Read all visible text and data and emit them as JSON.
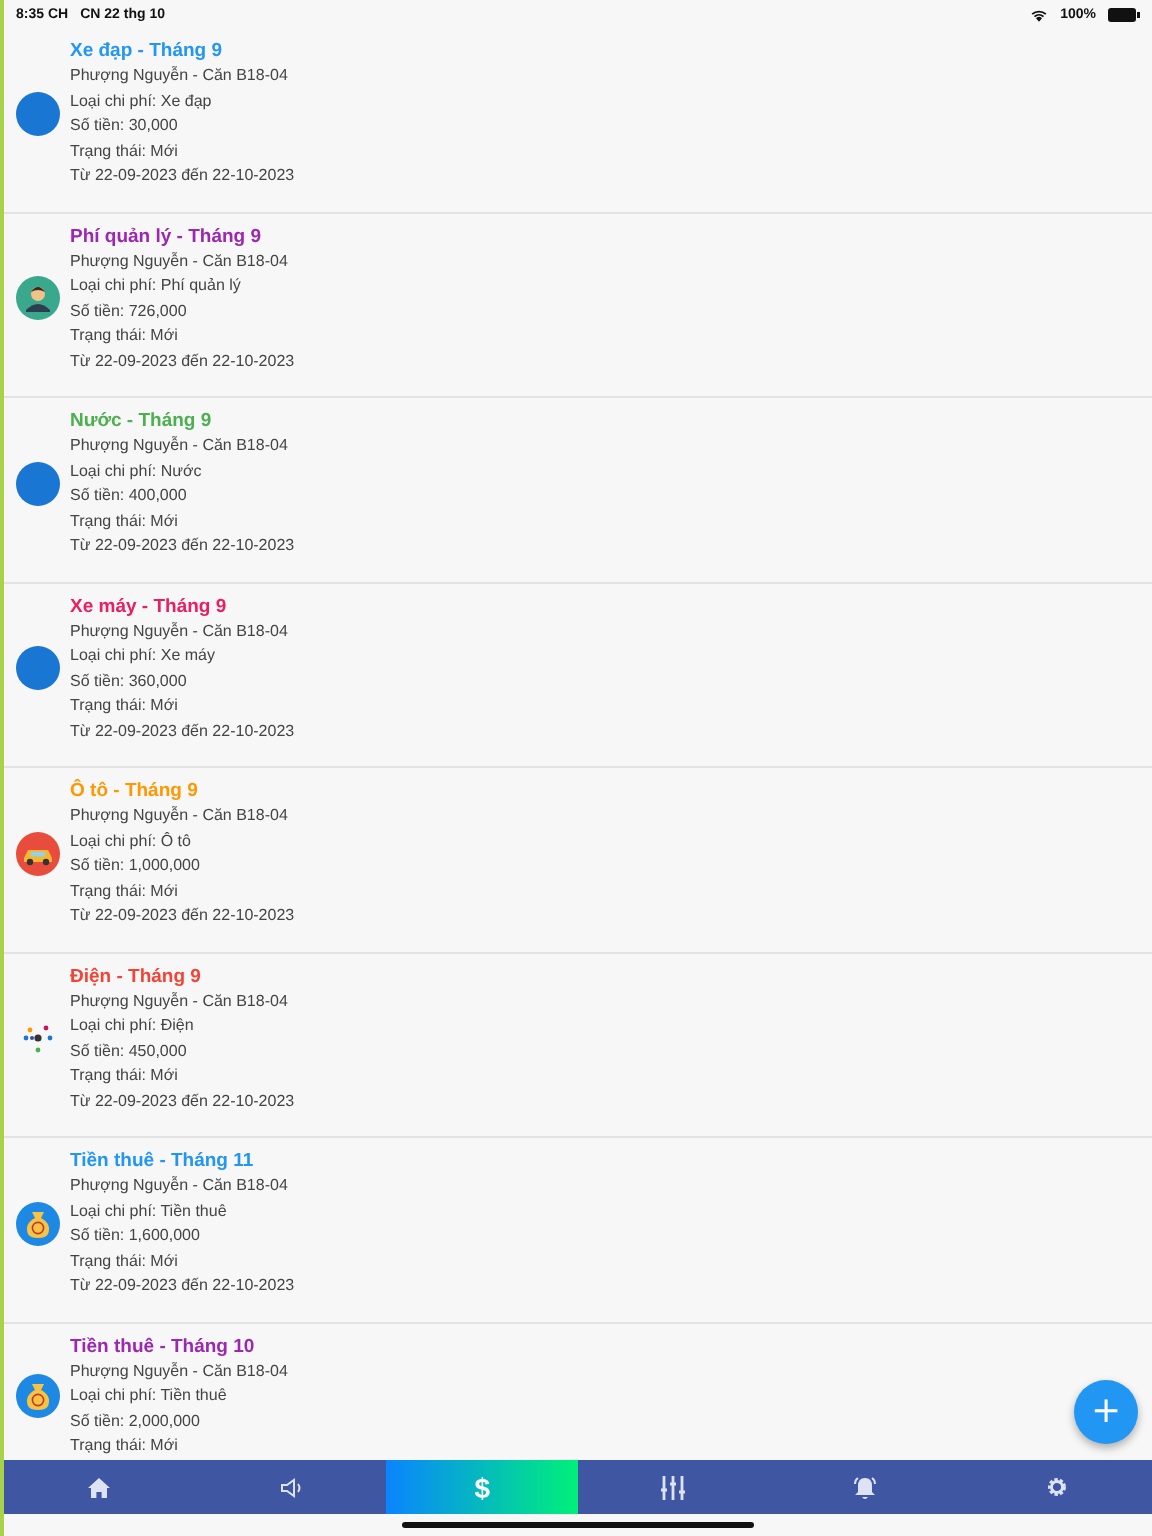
{
  "status_bar": {
    "time": "8:35 CH",
    "date": "CN 22 thg 10",
    "battery": "100%"
  },
  "expenses": [
    {
      "title": "Xe đạp - Tháng 9",
      "color": "#2196f3",
      "kind": "circle",
      "owner": "Phượng Nguyễn - Căn B18-04",
      "type": "Loại chi phí: Xe đạp",
      "amount": "Số tiền: 30,000",
      "status": "Trạng thái: Mới",
      "period": "Từ 22-09-2023 đến 22-10-2023"
    },
    {
      "title": "Phí quản lý - Tháng 9",
      "color": "#9c27b0",
      "kind": "person",
      "owner": "Phượng Nguyễn - Căn B18-04",
      "type": "Loại chi phí: Phí quản lý",
      "amount": "Số tiền: 726,000",
      "status": "Trạng thái: Mới",
      "period": "Từ 22-09-2023 đến 22-10-2023"
    },
    {
      "title": "Nước - Tháng 9",
      "color": "#4caf50",
      "kind": "circle",
      "owner": "Phượng Nguyễn - Căn B18-04",
      "type": "Loại chi phí: Nước",
      "amount": "Số tiền: 400,000",
      "status": "Trạng thái: Mới",
      "period": "Từ 22-09-2023 đến 22-10-2023"
    },
    {
      "title": "Xe máy - Tháng 9",
      "color": "#e91e63",
      "kind": "circle",
      "owner": "Phượng Nguyễn - Căn B18-04",
      "type": "Loại chi phí: Xe máy",
      "amount": "Số tiền: 360,000",
      "status": "Trạng thái: Mới",
      "period": "Từ 22-09-2023 đến 22-10-2023"
    },
    {
      "title": "Ô tô - Tháng 9",
      "color": "#ff9800",
      "kind": "car",
      "owner": "Phượng Nguyễn - Căn B18-04",
      "type": "Loại chi phí: Ô tô",
      "amount": "Số tiền: 1,000,000",
      "status": "Trạng thái: Mới",
      "period": "Từ 22-09-2023 đến 22-10-2023"
    },
    {
      "title": "Điện - Tháng 9",
      "color": "#f44336",
      "kind": "dots",
      "owner": "Phượng Nguyễn - Căn B18-04",
      "type": "Loại chi phí: Điện",
      "amount": "Số tiền: 450,000",
      "status": "Trạng thái: Mới",
      "period": "Từ 22-09-2023 đến 22-10-2023"
    },
    {
      "title": "Tiền thuê - Tháng 11",
      "color": "#2196f3",
      "kind": "moneybag",
      "owner": "Phượng Nguyễn - Căn B18-04",
      "type": "Loại chi phí: Tiền thuê",
      "amount": "Số tiền: 1,600,000",
      "status": "Trạng thái: Mới",
      "period": "Từ 22-09-2023 đến 22-10-2023"
    },
    {
      "title": "Tiền thuê - Tháng 10",
      "color": "#9c27b0",
      "kind": "moneybag",
      "owner": "Phượng Nguyễn - Căn B18-04",
      "type": "Loại chi phí: Tiền thuê",
      "amount": "Số tiền: 2,000,000",
      "status": "Trạng thái: Mới"
    }
  ],
  "fab": {
    "label": "+"
  },
  "nav": [
    {
      "kind": "home",
      "selected": false
    },
    {
      "kind": "speaker",
      "selected": false
    },
    {
      "kind": "dollar",
      "label": "$",
      "selected": true
    },
    {
      "kind": "sliders",
      "selected": false
    },
    {
      "kind": "bell",
      "selected": false
    },
    {
      "kind": "gear",
      "selected": false
    }
  ]
}
